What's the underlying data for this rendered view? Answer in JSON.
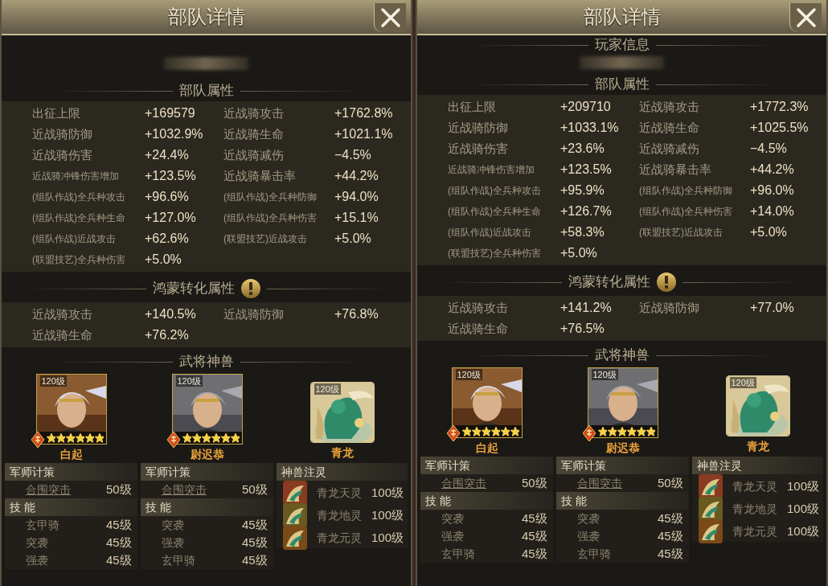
{
  "panels": [
    {
      "title": "部队详情",
      "troop_heading": "部队属性",
      "troop_stats": [
        {
          "label": "出征上限",
          "value": "+169579"
        },
        {
          "label": "近战骑攻击",
          "value": "+1762.8%"
        },
        {
          "label": "近战骑防御",
          "value": "+1032.9%"
        },
        {
          "label": "近战骑生命",
          "value": "+1021.1%"
        },
        {
          "label": "近战骑伤害",
          "value": "+24.4%"
        },
        {
          "label": "近战骑减伤",
          "value": "−4.5%"
        },
        {
          "label": "近战骑冲锋伤害增加",
          "value": "+123.5%"
        },
        {
          "label": "近战骑暴击率",
          "value": "+44.2%"
        },
        {
          "label": "(组队作战)全兵种攻击",
          "value": "+96.6%"
        },
        {
          "label": "(组队作战)全兵种防御",
          "value": "+94.0%"
        },
        {
          "label": "(组队作战)全兵种生命",
          "value": "+127.0%"
        },
        {
          "label": "(组队作战)全兵种伤害",
          "value": "+15.1%"
        },
        {
          "label": "(组队作战)近战攻击",
          "value": "+62.6%"
        },
        {
          "label": "(联盟技艺)近战攻击",
          "value": "+5.0%"
        },
        {
          "label": "(联盟技艺)全兵种伤害",
          "value": "+5.0%"
        }
      ],
      "conversion_heading": "鸿蒙转化属性",
      "conversion_stats": [
        {
          "label": "近战骑攻击",
          "value": "+140.5%"
        },
        {
          "label": "近战骑防御",
          "value": "+76.8%"
        },
        {
          "label": "近战骑生命",
          "value": "+76.2%"
        }
      ],
      "units_heading": "武将神兽",
      "units": [
        {
          "kind": "hero",
          "level": "120级",
          "stars": 6,
          "name": "白起",
          "strategy_heading": "军师计策",
          "strategy": {
            "name": "合围突击",
            "level": "50级"
          },
          "skills_heading": "技 能",
          "skills": [
            {
              "name": "玄甲骑",
              "level": "45级"
            },
            {
              "name": "突袭",
              "level": "45级"
            },
            {
              "name": "强袭",
              "level": "45级"
            }
          ]
        },
        {
          "kind": "hero",
          "level": "120级",
          "stars": 6,
          "name": "尉迟恭",
          "strategy_heading": "军师计策",
          "strategy": {
            "name": "合围突击",
            "level": "50级"
          },
          "skills_heading": "技 能",
          "skills": [
            {
              "name": "突袭",
              "level": "45级"
            },
            {
              "name": "强袭",
              "level": "45级"
            },
            {
              "name": "玄甲骑",
              "level": "45级"
            }
          ]
        },
        {
          "kind": "beast",
          "level": "120级",
          "name": "青龙",
          "infusion_heading": "神兽注灵",
          "infusions": [
            {
              "name": "青龙天灵",
              "level": "100级"
            },
            {
              "name": "青龙地灵",
              "level": "100级"
            },
            {
              "name": "青龙元灵",
              "level": "100级"
            }
          ]
        }
      ]
    },
    {
      "title": "部队详情",
      "player_heading": "玩家信息",
      "troop_heading": "部队属性",
      "troop_stats": [
        {
          "label": "出征上限",
          "value": "+209710"
        },
        {
          "label": "近战骑攻击",
          "value": "+1772.3%"
        },
        {
          "label": "近战骑防御",
          "value": "+1033.1%"
        },
        {
          "label": "近战骑生命",
          "value": "+1025.5%"
        },
        {
          "label": "近战骑伤害",
          "value": "+23.6%"
        },
        {
          "label": "近战骑减伤",
          "value": "−4.5%"
        },
        {
          "label": "近战骑冲锋伤害增加",
          "value": "+123.5%"
        },
        {
          "label": "近战骑暴击率",
          "value": "+44.2%"
        },
        {
          "label": "(组队作战)全兵种攻击",
          "value": "+95.9%"
        },
        {
          "label": "(组队作战)全兵种防御",
          "value": "+96.0%"
        },
        {
          "label": "(组队作战)全兵种生命",
          "value": "+126.7%"
        },
        {
          "label": "(组队作战)全兵种伤害",
          "value": "+14.0%"
        },
        {
          "label": "(组队作战)近战攻击",
          "value": "+58.3%"
        },
        {
          "label": "(联盟技艺)近战攻击",
          "value": "+5.0%"
        },
        {
          "label": "(联盟技艺)全兵种伤害",
          "value": "+5.0%"
        }
      ],
      "conversion_heading": "鸿蒙转化属性",
      "conversion_stats": [
        {
          "label": "近战骑攻击",
          "value": "+141.2%"
        },
        {
          "label": "近战骑防御",
          "value": "+77.0%"
        },
        {
          "label": "近战骑生命",
          "value": "+76.5%"
        }
      ],
      "units_heading": "武将神兽",
      "units": [
        {
          "kind": "hero",
          "level": "120级",
          "stars": 6,
          "name": "白起",
          "strategy_heading": "军师计策",
          "strategy": {
            "name": "合围突击",
            "level": "50级"
          },
          "skills_heading": "技 能",
          "skills": [
            {
              "name": "突袭",
              "level": "45级"
            },
            {
              "name": "强袭",
              "level": "45级"
            },
            {
              "name": "玄甲骑",
              "level": "45级"
            }
          ]
        },
        {
          "kind": "hero",
          "level": "120级",
          "stars": 6,
          "name": "尉迟恭",
          "strategy_heading": "军师计策",
          "strategy": {
            "name": "合围突击",
            "level": "50级"
          },
          "skills_heading": "技 能",
          "skills": [
            {
              "name": "突袭",
              "level": "45级"
            },
            {
              "name": "强袭",
              "level": "45级"
            },
            {
              "name": "玄甲骑",
              "level": "45级"
            }
          ]
        },
        {
          "kind": "beast",
          "level": "120级",
          "name": "青龙",
          "infusion_heading": "神兽注灵",
          "infusions": [
            {
              "name": "青龙天灵",
              "level": "100级"
            },
            {
              "name": "青龙地灵",
              "level": "100级"
            },
            {
              "name": "青龙元灵",
              "level": "100级"
            }
          ]
        }
      ]
    }
  ]
}
